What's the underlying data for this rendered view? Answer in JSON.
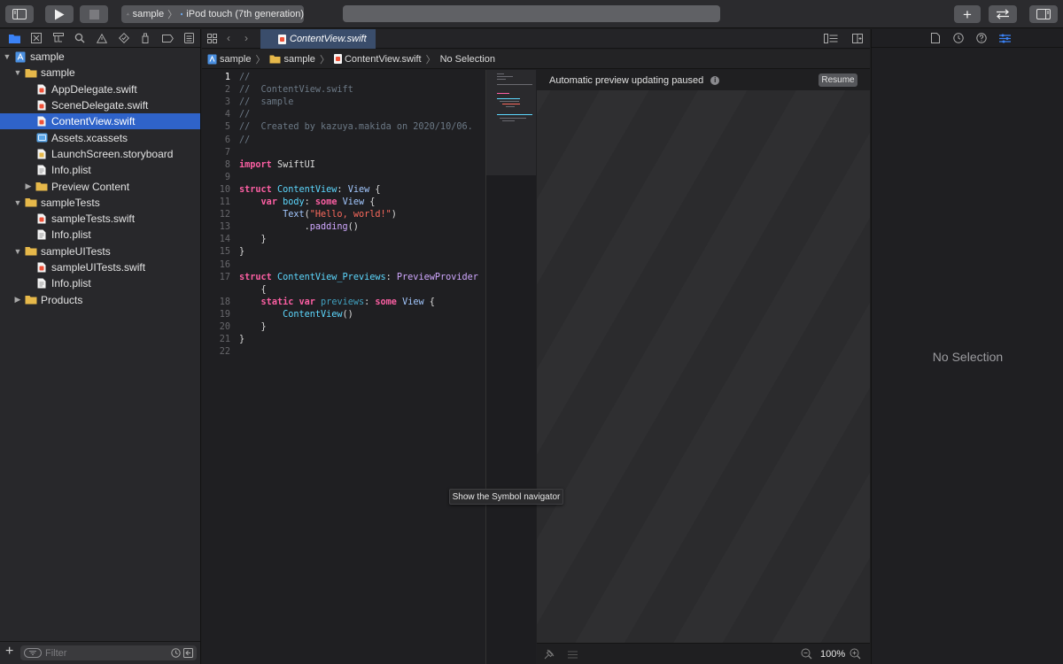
{
  "toolbar": {
    "scheme_target": "sample",
    "scheme_device": "iPod touch (7th generation)",
    "add_label": "+"
  },
  "navigator": {
    "tree": [
      {
        "label": "sample",
        "type": "project",
        "depth": 0,
        "expanded": true
      },
      {
        "label": "sample",
        "type": "folder",
        "depth": 1,
        "expanded": true
      },
      {
        "label": "AppDelegate.swift",
        "type": "swift",
        "depth": 2
      },
      {
        "label": "SceneDelegate.swift",
        "type": "swift",
        "depth": 2
      },
      {
        "label": "ContentView.swift",
        "type": "swift",
        "depth": 2,
        "selected": true
      },
      {
        "label": "Assets.xcassets",
        "type": "assets",
        "depth": 2
      },
      {
        "label": "LaunchScreen.storyboard",
        "type": "storyboard",
        "depth": 2
      },
      {
        "label": "Info.plist",
        "type": "plist",
        "depth": 2
      },
      {
        "label": "Preview Content",
        "type": "folder",
        "depth": 2,
        "expanded": false
      },
      {
        "label": "sampleTests",
        "type": "folder",
        "depth": 1,
        "expanded": true
      },
      {
        "label": "sampleTests.swift",
        "type": "swift",
        "depth": 2
      },
      {
        "label": "Info.plist",
        "type": "plist",
        "depth": 2
      },
      {
        "label": "sampleUITests",
        "type": "folder",
        "depth": 1,
        "expanded": true
      },
      {
        "label": "sampleUITests.swift",
        "type": "swift",
        "depth": 2
      },
      {
        "label": "Info.plist",
        "type": "plist",
        "depth": 2
      },
      {
        "label": "Products",
        "type": "folder",
        "depth": 1,
        "expanded": false
      }
    ],
    "filter_placeholder": "Filter"
  },
  "editor": {
    "tab_label": "ContentView.swift",
    "jumpbar": [
      "sample",
      "sample",
      "ContentView.swift",
      "No Selection"
    ],
    "current_line": 1,
    "lines": [
      {
        "n": "1",
        "tokens": [
          [
            "cm",
            "//"
          ]
        ]
      },
      {
        "n": "2",
        "tokens": [
          [
            "cm",
            "//  ContentView.swift"
          ]
        ]
      },
      {
        "n": "3",
        "tokens": [
          [
            "cm",
            "//  sample"
          ]
        ]
      },
      {
        "n": "4",
        "tokens": [
          [
            "cm",
            "//"
          ]
        ]
      },
      {
        "n": "5",
        "tokens": [
          [
            "cm",
            "//  Created by kazuya.makida on 2020/10/06."
          ]
        ]
      },
      {
        "n": "6",
        "tokens": [
          [
            "cm",
            "//"
          ]
        ]
      },
      {
        "n": "7",
        "tokens": []
      },
      {
        "n": "8",
        "tokens": [
          [
            "kw",
            "import"
          ],
          [
            "",
            " SwiftUI"
          ]
        ]
      },
      {
        "n": "9",
        "tokens": []
      },
      {
        "n": "10",
        "tokens": [
          [
            "kw",
            "struct"
          ],
          [
            "",
            " "
          ],
          [
            "ty",
            "ContentView"
          ],
          [
            "",
            ": "
          ],
          [
            "ty2",
            "View"
          ],
          [
            "",
            " {"
          ]
        ]
      },
      {
        "n": "11",
        "tokens": [
          [
            "",
            "    "
          ],
          [
            "kw",
            "var"
          ],
          [
            "",
            " "
          ],
          [
            "ty",
            "body"
          ],
          [
            "",
            ": "
          ],
          [
            "kw",
            "some"
          ],
          [
            "",
            " "
          ],
          [
            "ty2",
            "View"
          ],
          [
            "",
            " {"
          ]
        ]
      },
      {
        "n": "12",
        "tokens": [
          [
            "",
            "        "
          ],
          [
            "ty2",
            "Text"
          ],
          [
            "",
            "("
          ],
          [
            "st",
            "\"Hello, world!\""
          ],
          [
            "",
            ")"
          ]
        ]
      },
      {
        "n": "13",
        "tokens": [
          [
            "",
            "            ."
          ],
          [
            "fn",
            "padding"
          ],
          [
            "",
            "()"
          ]
        ]
      },
      {
        "n": "14",
        "tokens": [
          [
            "",
            "    }"
          ]
        ]
      },
      {
        "n": "15",
        "tokens": [
          [
            "",
            "}"
          ]
        ]
      },
      {
        "n": "16",
        "tokens": []
      },
      {
        "n": "17",
        "tokens": [
          [
            "kw",
            "struct"
          ],
          [
            "",
            " "
          ],
          [
            "ty",
            "ContentView_Previews"
          ],
          [
            "",
            ": "
          ],
          [
            "fn",
            "PreviewProvider"
          ]
        ]
      },
      {
        "n": "",
        "tokens": [
          [
            "",
            "    {"
          ]
        ]
      },
      {
        "n": "18",
        "tokens": [
          [
            "",
            "    "
          ],
          [
            "kw",
            "static"
          ],
          [
            "",
            " "
          ],
          [
            "kw",
            "var"
          ],
          [
            "",
            " "
          ],
          [
            "pv",
            "previews"
          ],
          [
            "",
            ": "
          ],
          [
            "kw",
            "some"
          ],
          [
            "",
            " "
          ],
          [
            "ty2",
            "View"
          ],
          [
            "",
            " {"
          ]
        ]
      },
      {
        "n": "19",
        "tokens": [
          [
            "",
            "        "
          ],
          [
            "ty",
            "ContentView"
          ],
          [
            "",
            "()"
          ]
        ]
      },
      {
        "n": "20",
        "tokens": [
          [
            "",
            "    }"
          ]
        ]
      },
      {
        "n": "21",
        "tokens": [
          [
            "",
            "}"
          ]
        ]
      },
      {
        "n": "22",
        "tokens": []
      }
    ]
  },
  "canvas": {
    "status": "Automatic preview updating paused",
    "resume_label": "Resume",
    "zoom": "100%"
  },
  "tooltip": "Show the Symbol navigator",
  "inspector": {
    "empty_label": "No Selection"
  },
  "colors": {
    "selection": "#2f63c9",
    "folder": "#e6b84a",
    "swift": "#f05138",
    "keyword": "#fc5fa3",
    "type": "#5dd8ff",
    "string": "#fc6a5d",
    "comment": "#6c7986"
  }
}
